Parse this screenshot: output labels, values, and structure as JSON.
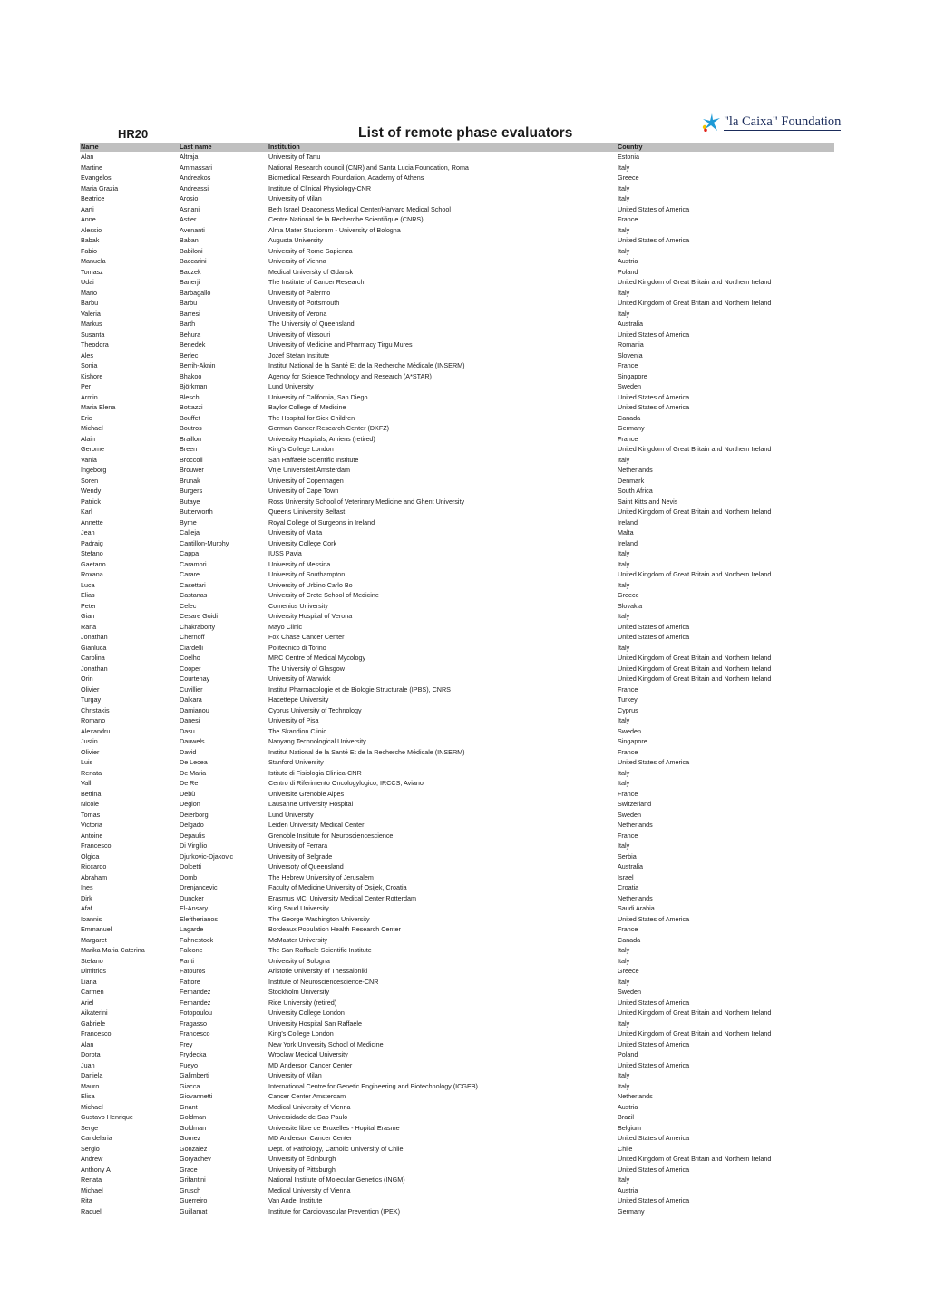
{
  "header": {
    "code": "HR20",
    "title": "List of remote phase evaluators",
    "logo_text": "\"la Caixa\" Foundation",
    "logo_icon": "star-icon",
    "header_bar_color": "#c0c0c0"
  },
  "columns": [
    "Name",
    "Last name",
    "Institution",
    "Country"
  ],
  "rows": [
    [
      "Alan",
      "Altraja",
      "University of Tartu",
      "Estonia"
    ],
    [
      "Martine",
      "Ammassari",
      "National Research council (CNR) and Santa Lucia Foundation, Roma",
      "Italy"
    ],
    [
      "Evangelos",
      "Andreakos",
      "Biomedical Research Foundation, Academy of Athens",
      "Greece"
    ],
    [
      "Maria Grazia",
      "Andreassi",
      "Institute of Clinical Physiology-CNR",
      "Italy"
    ],
    [
      "Beatrice",
      "Arosio",
      "University of Milan",
      "Italy"
    ],
    [
      "Aarti",
      "Asnani",
      "Beth Israel Deaconess Medical Center/Harvard Medical School",
      "United States of America"
    ],
    [
      "Anne",
      "Astier",
      "Centre National de la Recherche Scientifique (CNRS)",
      "France"
    ],
    [
      "Alessio",
      "Avenanti",
      "Alma Mater Studiorum - University of Bologna",
      "Italy"
    ],
    [
      "Babak",
      "Baban",
      "Augusta University",
      "United States of America"
    ],
    [
      "Fabio",
      "Babiloni",
      "University of Rome Sapienza",
      "Italy"
    ],
    [
      "Manuela",
      "Baccarini",
      "University of Vienna",
      "Austria"
    ],
    [
      "Tomasz",
      "Baczek",
      "Medical University of Gdansk",
      "Poland"
    ],
    [
      "Udai",
      "Banerji",
      "The Institute of Cancer Research",
      "United Kingdom of Great Britain and Northern Ireland"
    ],
    [
      "Mario",
      "Barbagallo",
      "University of Palermo",
      "Italy"
    ],
    [
      "Barbu",
      "Barbu",
      "University of Portsmouth",
      "United Kingdom of Great Britain and Northern Ireland"
    ],
    [
      "Valeria",
      "Barresi",
      "University of Verona",
      "Italy"
    ],
    [
      "Markus",
      "Barth",
      "The University of Queensland",
      "Australia"
    ],
    [
      "Susanta",
      "Behura",
      "University of Missouri",
      "United States of America"
    ],
    [
      "Theodora",
      "Benedek",
      "University of Medicine and Pharmacy Tirgu Mures",
      "Romania"
    ],
    [
      "Ales",
      "Berlec",
      "Jozef Stefan Institute",
      "Slovenia"
    ],
    [
      "Sonia",
      "Berrih-Aknin",
      "Institut National de la Santé Et de la Recherche Médicale (INSERM)",
      "France"
    ],
    [
      "Kishore",
      "Bhakoo",
      "Agency for Science Technology and Research (A*STAR)",
      "Singapore"
    ],
    [
      "Per",
      "Björkman",
      "Lund University",
      "Sweden"
    ],
    [
      "Armin",
      "Blesch",
      "University of California, San Diego",
      "United States of America"
    ],
    [
      "Maria Elena",
      "Bottazzi",
      "Baylor College of Medicine",
      "United States of America"
    ],
    [
      "Eric",
      "Bouffet",
      "The Hospital for Sick Children",
      "Canada"
    ],
    [
      "Michael",
      "Boutros",
      "German Cancer Research Center (DKFZ)",
      "Germany"
    ],
    [
      "Alain",
      "Braillon",
      "University Hospitals, Amiens (retired)",
      "France"
    ],
    [
      "Gerome",
      "Breen",
      "King's College London",
      "United Kingdom of Great Britain and Northern Ireland"
    ],
    [
      "Vania",
      "Broccoli",
      "San Raffaele Scientific Institute",
      "Italy"
    ],
    [
      "Ingeborg",
      "Brouwer",
      "Vrije Universiteit Amsterdam",
      "Netherlands"
    ],
    [
      "Soren",
      "Brunak",
      "University of Copenhagen",
      "Denmark"
    ],
    [
      "Wendy",
      "Burgers",
      "University of Cape Town",
      "South Africa"
    ],
    [
      "Patrick",
      "Butaye",
      "Ross University School of Veterinary Medicine and Ghent University",
      "Saint Kitts and Nevis"
    ],
    [
      "Karl",
      "Butterworth",
      "Queens Uiniversity Belfast",
      "United Kingdom of Great Britain and Northern Ireland"
    ],
    [
      "Annette",
      "Byrne",
      "Royal College of Surgeons in Ireland",
      "Ireland"
    ],
    [
      "Jean",
      "Calleja",
      "University of Malta",
      "Malta"
    ],
    [
      "Padraig",
      "Cantillon-Murphy",
      "University College Cork",
      "Ireland"
    ],
    [
      "Stefano",
      "Cappa",
      "IUSS Pavia",
      "Italy"
    ],
    [
      "Gaetano",
      "Caramori",
      "University of Messina",
      "Italy"
    ],
    [
      "Roxana",
      "Carare",
      "University of Southampton",
      "United Kingdom of Great Britain and Northern Ireland"
    ],
    [
      "Luca",
      "Casettari",
      "University of Urbino Carlo Bo",
      "Italy"
    ],
    [
      "Elias",
      "Castanas",
      "University of Crete School of Medicine",
      "Greece"
    ],
    [
      "Peter",
      "Celec",
      "Comenius University",
      "Slovakia"
    ],
    [
      "Gian",
      "Cesare Guidi",
      "University Hospital of Verona",
      "Italy"
    ],
    [
      "Rana",
      "Chakraborty",
      "Mayo Clinic",
      "United States of America"
    ],
    [
      "Jonathan",
      "Chernoff",
      "Fox Chase Cancer Center",
      "United States of America"
    ],
    [
      "Gianluca",
      "Ciardelli",
      "Politecnico di Torino",
      "Italy"
    ],
    [
      "Carolina",
      "Coelho",
      "MRC Centre of Medical Mycology",
      "United Kingdom of Great Britain and Northern Ireland"
    ],
    [
      "Jonathan",
      "Cooper",
      "The University of Glasgow",
      "United Kingdom of Great Britain and Northern Ireland"
    ],
    [
      "Orin",
      "Courtenay",
      "University of Warwick",
      "United Kingdom of Great Britain and Northern Ireland"
    ],
    [
      "Olivier",
      "Cuvillier",
      "Institut Pharmacologie et de Biologie Structurale (IPBS), CNRS",
      "France"
    ],
    [
      "Turgay",
      "Dalkara",
      "Hacettepe University",
      "Turkey"
    ],
    [
      "Christakis",
      "Damianou",
      "Cyprus University of Technology",
      "Cyprus"
    ],
    [
      "Romano",
      "Danesi",
      "University of Pisa",
      "Italy"
    ],
    [
      "Alexandru",
      "Dasu",
      "The Skandion Clinic",
      "Sweden"
    ],
    [
      "Justin",
      "Dauwels",
      "Nanyang Technological University",
      "Singapore"
    ],
    [
      "Olivier",
      "David",
      "Institut National de la Santé Et de la Recherche Médicale (INSERM)",
      "France"
    ],
    [
      "Luis",
      "De Lecea",
      "Stanford University",
      "United States of America"
    ],
    [
      "Renata",
      "De Maria",
      "Istituto di Fisiologia Clinica-CNR",
      "Italy"
    ],
    [
      "Valli",
      "De Re",
      "Centro di Riferimento Oncologylogico, IRCCS, Aviano",
      "Italy"
    ],
    [
      "Bettina",
      "Debù",
      "Universite Grenoble Alpes",
      "France"
    ],
    [
      "Nicole",
      "Deglon",
      "Lausanne University Hospital",
      "Switzerland"
    ],
    [
      "Tomas",
      "Deierborg",
      "Lund University",
      "Sweden"
    ],
    [
      "Victoria",
      "Delgado",
      "Leiden University Medical Center",
      "Netherlands"
    ],
    [
      "Antoine",
      "Depaulis",
      "Grenoble Institute for Neurosciencescience",
      "France"
    ],
    [
      "Francesco",
      "Di Virgilio",
      "University of Ferrara",
      "Italy"
    ],
    [
      "Olgica",
      "Djurkovic-Djakovic",
      "University of Belgrade",
      "Serbia"
    ],
    [
      "Riccardo",
      "Dolcetti",
      "Universoty of Queensland",
      "Australia"
    ],
    [
      "Abraham",
      "Domb",
      "The Hebrew University of Jerusalem",
      "Israel"
    ],
    [
      "Ines",
      "Drenjancevic",
      "Faculty of Medicine University of Osijek, Croatia",
      "Croatia"
    ],
    [
      "Dirk",
      "Duncker",
      "Erasmus MC, University Medical Center Rotterdam",
      "Netherlands"
    ],
    [
      "Afaf",
      "El-Ansary",
      "King Saud University",
      "Saudi Arabia"
    ],
    [
      "Ioannis",
      "Eleftherianos",
      "The George Washington University",
      "United States of America"
    ],
    [
      "Emmanuel",
      "Lagarde",
      "Bordeaux Population Health Research Center",
      "France"
    ],
    [
      "Margaret",
      "Fahnestock",
      "McMaster University",
      "Canada"
    ],
    [
      "Marika Maria Caterina",
      "Falcone",
      "The San Raffaele Scientific Institute",
      "Italy"
    ],
    [
      "Stefano",
      "Fanti",
      "University of Bologna",
      "Italy"
    ],
    [
      "Dimitrios",
      "Fatouros",
      "Aristotle University of Thessaloniki",
      "Greece"
    ],
    [
      "Liana",
      "Fattore",
      "Institute of Neurosciencescience-CNR",
      "Italy"
    ],
    [
      "Carmen",
      "Fernandez",
      "Stockholm University",
      "Sweden"
    ],
    [
      "Ariel",
      "Fernandez",
      "Rice University (retired)",
      "United States of America"
    ],
    [
      "Aikaterini",
      "Fotopoulou",
      "University College London",
      "United Kingdom of Great Britain and Northern Ireland"
    ],
    [
      "Gabriele",
      "Fragasso",
      "University Hospital San Raffaele",
      "Italy"
    ],
    [
      "Francesco",
      "Francesco",
      "King's College London",
      "United Kingdom of Great Britain and Northern Ireland"
    ],
    [
      "Alan",
      "Frey",
      "New York University School of Medicine",
      "United States of America"
    ],
    [
      "Dorota",
      "Frydecka",
      "Wroclaw Medical University",
      "Poland"
    ],
    [
      "Juan",
      "Fueyo",
      "MD Anderson Cancer Center",
      "United States of America"
    ],
    [
      "Daniela",
      "Galimberti",
      "University of Milan",
      "Italy"
    ],
    [
      "Mauro",
      "Giacca",
      "International Centre for Genetic Engineering and Biotechnology (ICGEB)",
      "Italy"
    ],
    [
      "Elisa",
      "Giovannetti",
      "Cancer Center Amsterdam",
      "Netherlands"
    ],
    [
      "Michael",
      "Gnant",
      "Medical University of Vienna",
      "Austria"
    ],
    [
      "Gustavo Henrique",
      "Goldman",
      "Universidade de Sao Paulo",
      "Brazil"
    ],
    [
      "Serge",
      "Goldman",
      "Universite libre de Bruxelles - Hopital Erasme",
      "Belgium"
    ],
    [
      "Candelaria",
      "Gomez",
      "MD Anderson Cancer Center",
      "United States of America"
    ],
    [
      "Sergio",
      "Gonzalez",
      "Dept. of Pathology, Catholic University of Chile",
      "Chile"
    ],
    [
      "Andrew",
      "Goryachev",
      "University of Edinburgh",
      "United Kingdom of Great Britain and Northern Ireland"
    ],
    [
      "Anthony A",
      "Grace",
      "University of Pittsburgh",
      "United States of America"
    ],
    [
      "Renata",
      "Grifantini",
      "National Institute of Molecular Genetics (INGM)",
      "Italy"
    ],
    [
      "Michael",
      "Grusch",
      "Medical University of Vienna",
      "Austria"
    ],
    [
      "Rita",
      "Guerreiro",
      "Van Andel Institute",
      "United States of America"
    ],
    [
      "Raquel",
      "Guillamat",
      "Institute for Cardiovascular Prevention (IPEK)",
      "Germany"
    ]
  ]
}
